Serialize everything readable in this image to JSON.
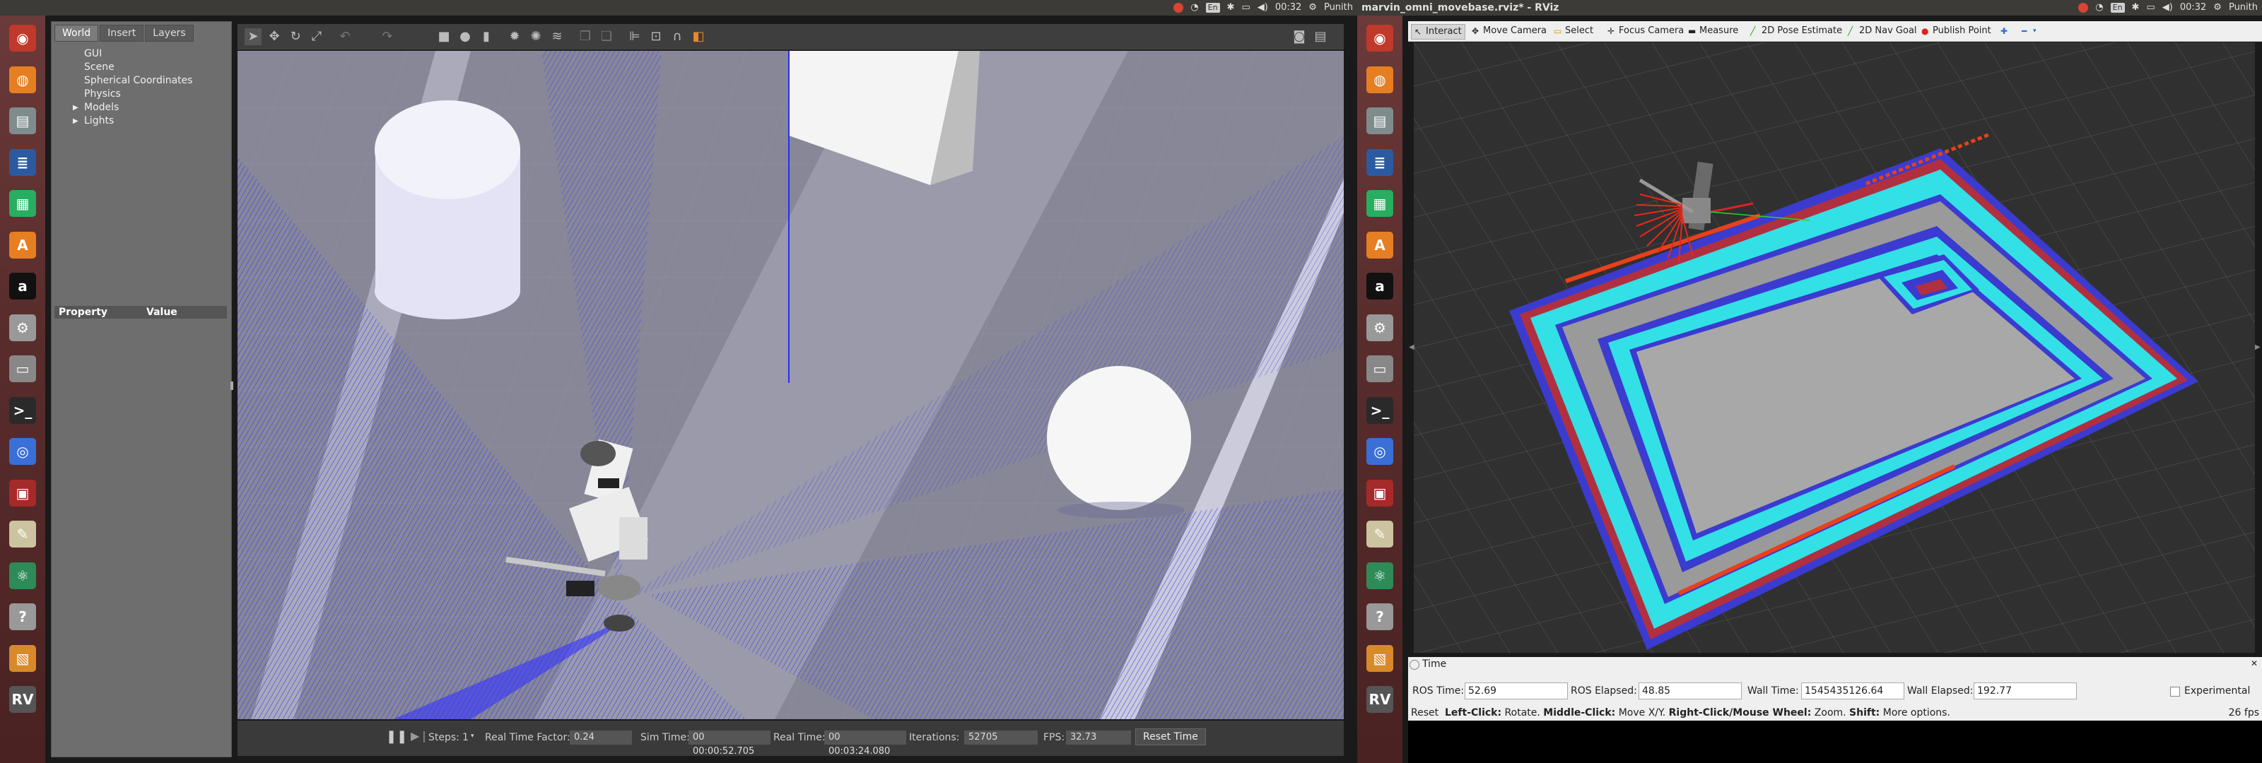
{
  "topbar": {
    "left_time": "00:32",
    "left_user": "Punith",
    "title": "marvin_omni_movebase.rviz* - RViz",
    "right_time": "00:32",
    "right_user": "Punith",
    "kb": "En"
  },
  "gazebo": {
    "tabs": [
      "World",
      "Insert",
      "Layers"
    ],
    "tree": [
      "GUI",
      "Scene",
      "Spherical Coordinates",
      "Physics",
      "Models",
      "Lights"
    ],
    "props_header": [
      "Property",
      "Value"
    ],
    "bottom": {
      "steps_label": "Steps:",
      "steps_value": "1",
      "rtf_label": "Real Time Factor:",
      "rtf_value": "0.24",
      "sim_label": "Sim Time:",
      "sim_value": "00 00:00:52.705",
      "real_label": "Real Time:",
      "real_value": "00 00:03:24.080",
      "iter_label": "Iterations:",
      "iter_value": "52705",
      "fps_label": "FPS:",
      "fps_value": "32.73",
      "reset_label": "Reset Time"
    }
  },
  "rviz": {
    "tools": [
      "Interact",
      "Move Camera",
      "Select",
      "Focus Camera",
      "Measure",
      "2D Pose Estimate",
      "2D Nav Goal",
      "Publish Point"
    ],
    "time_title": "Time",
    "ros_time_label": "ROS Time:",
    "ros_time": "52.69",
    "ros_elapsed_label": "ROS Elapsed:",
    "ros_elapsed": "48.85",
    "wall_time_label": "Wall Time:",
    "wall_time": "1545435126.64",
    "wall_elapsed_label": "Wall Elapsed:",
    "wall_elapsed": "192.77",
    "experimental_label": "Experimental",
    "reset": "Reset",
    "hint_left": "Left-Click:",
    "hint_left_text": "Rotate.",
    "hint_middle": "Middle-Click:",
    "hint_middle_text": "Move X/Y.",
    "hint_right": "Right-Click/Mouse Wheel:",
    "hint_right_text": "Zoom.",
    "hint_shift": "Shift:",
    "hint_shift_text": "More options.",
    "fps": "26 fps"
  },
  "launcher_icons": [
    "ubuntu-icon",
    "firefox-icon",
    "files-icon",
    "writer-icon",
    "calc-icon",
    "software-center-icon",
    "amazon-icon",
    "settings-icon",
    "drive-icon",
    "terminal-icon",
    "chromium-icon",
    "monitor-icon",
    "editor-icon",
    "atom-icon",
    "help-icon",
    "gazebo-icon",
    "rviz-icon"
  ]
}
